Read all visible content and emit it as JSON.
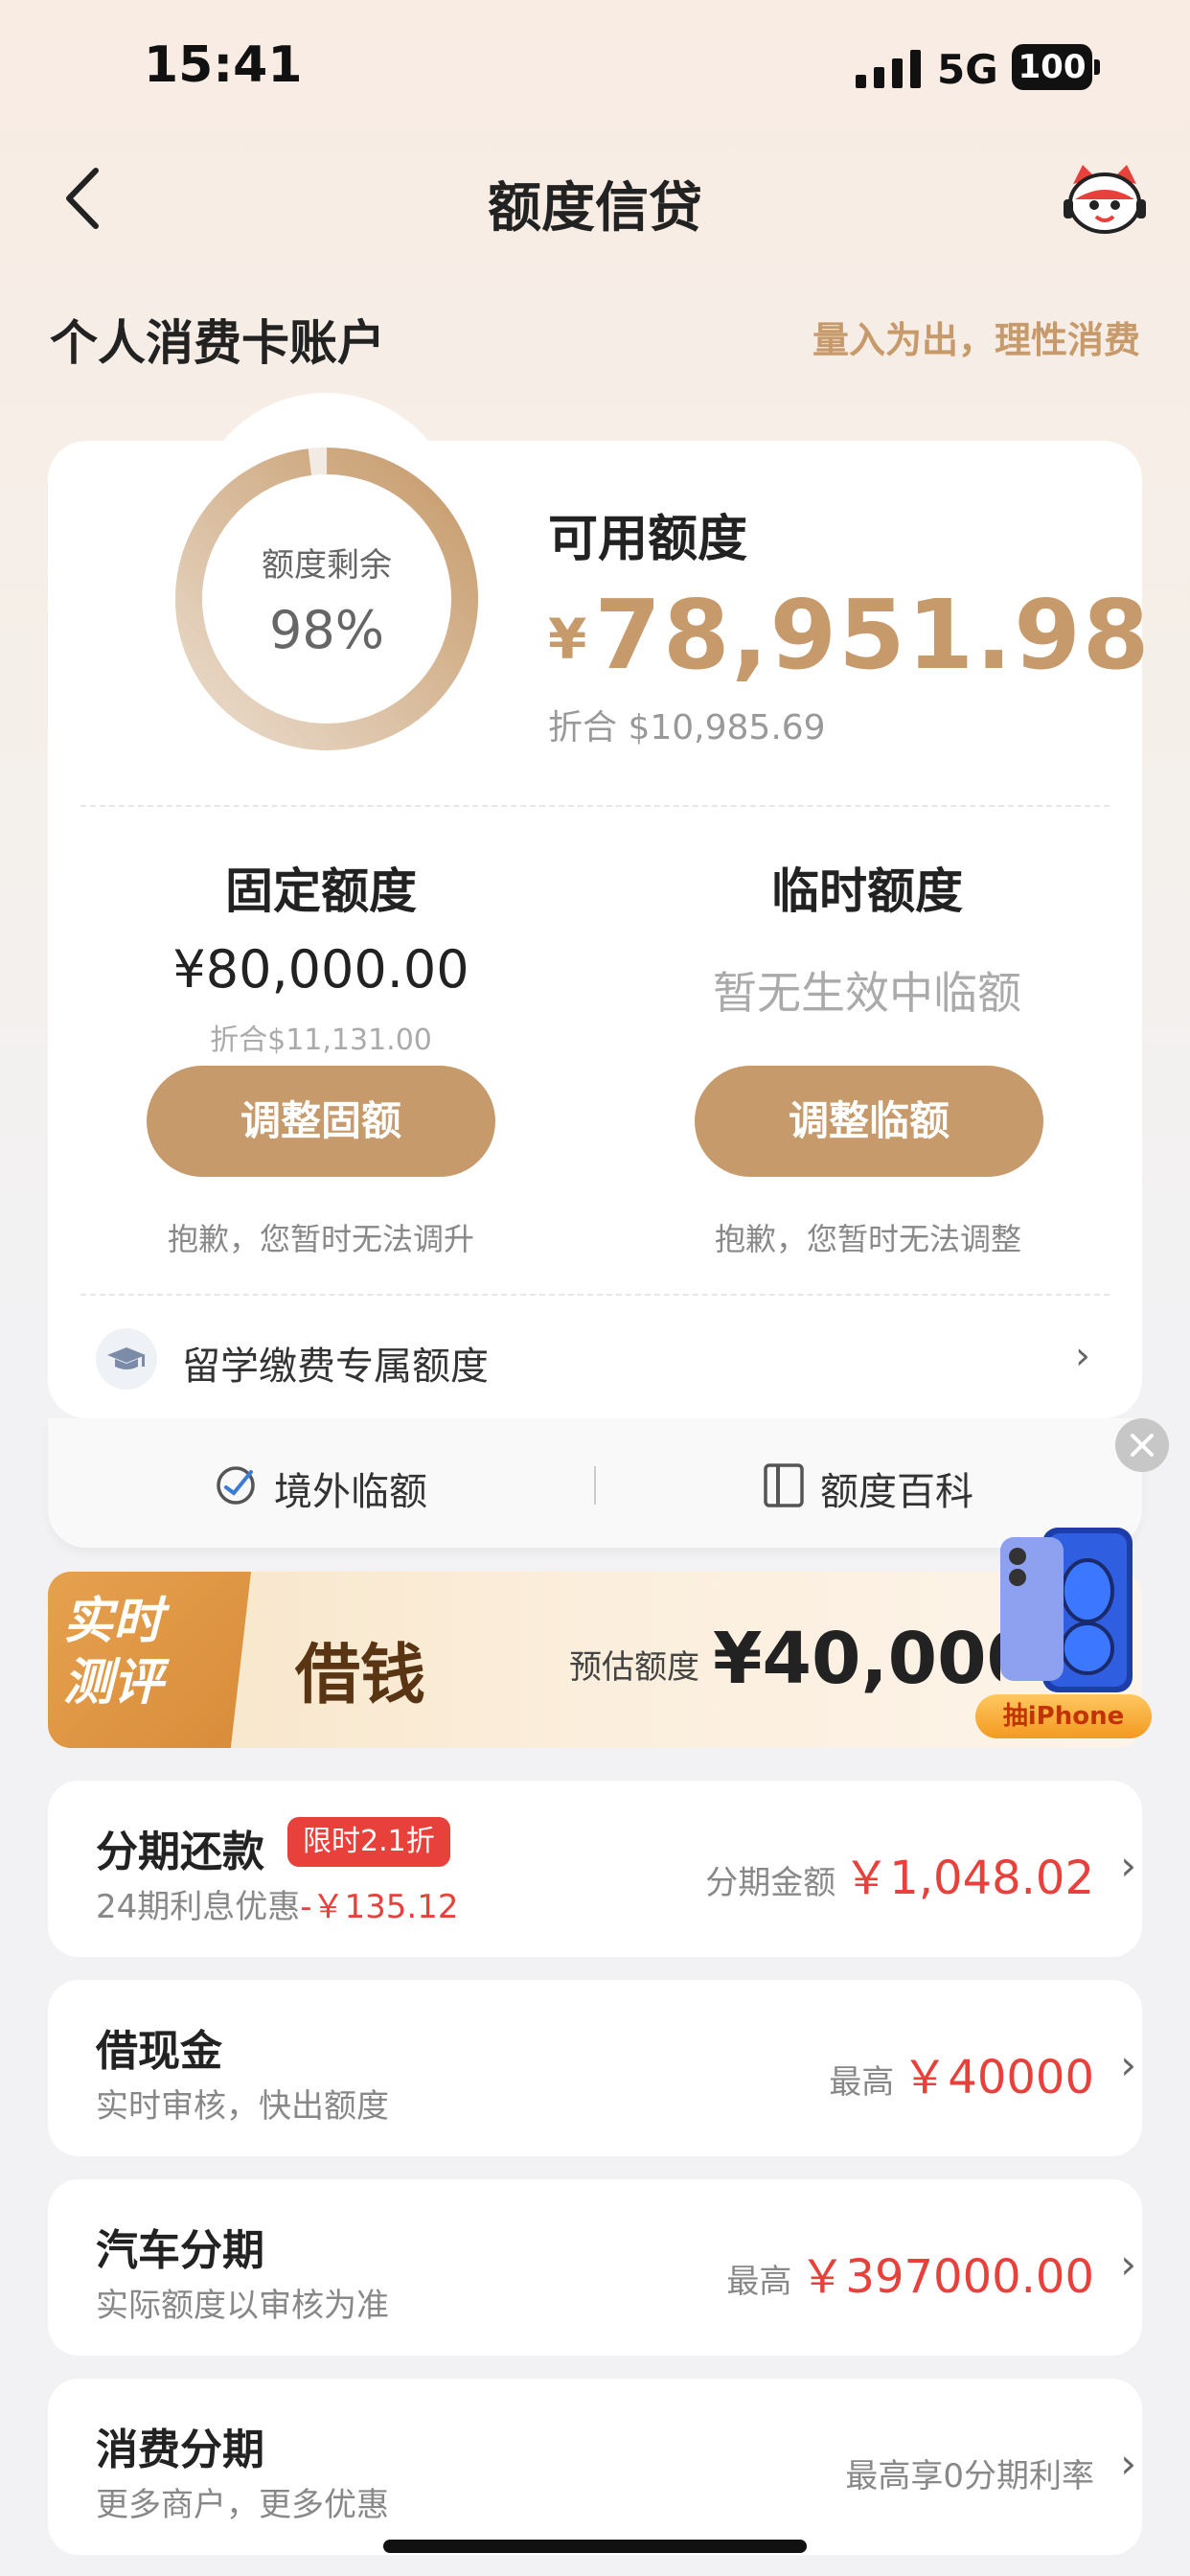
{
  "status_bar": {
    "time": "15:41",
    "network": "5G",
    "battery": "100"
  },
  "nav": {
    "title": "额度信贷"
  },
  "section": {
    "title": "个人消费卡账户",
    "slogan": "量入为出，理性消费"
  },
  "credit": {
    "ring_label": "额度剩余",
    "ring_percent": "98%",
    "ring_fraction": 0.98,
    "available_label": "可用额度",
    "currency": "¥",
    "available_amount": "78,951.98",
    "available_converted": "折合 $10,985.69"
  },
  "fixed": {
    "title": "固定额度",
    "amount": "¥80,000.00",
    "converted": "折合$11,131.00",
    "button": "调整固额",
    "note": "抱歉，您暂时无法调升"
  },
  "temporary": {
    "title": "临时额度",
    "status": "暂无生效中临额",
    "button": "调整临额",
    "note": "抱歉，您暂时无法调整"
  },
  "study": {
    "label": "留学缴费专属额度"
  },
  "strip": {
    "overseas": "境外临额",
    "wiki": "额度百科"
  },
  "banner": {
    "tag_line1": "实时",
    "tag_line2": "测评",
    "title": "借钱",
    "estimate_label": "预估额度",
    "estimate_amount": "¥40,000.0",
    "promo": "抽iPhone"
  },
  "list": [
    {
      "title": "分期还款",
      "badge": "限时2.1折",
      "sub_prefix": "24期利息优惠",
      "sub_discount": "-￥135.12",
      "right_label": "分期金额",
      "right_value": "￥1,048.02"
    },
    {
      "title": "借现金",
      "sub": "实时审核，快出额度",
      "right_label": "最高",
      "right_value": "￥40000"
    },
    {
      "title": "汽车分期",
      "sub": "实际额度以审核为准",
      "right_label": "最高",
      "right_value": "￥397000.00"
    },
    {
      "title": "消费分期",
      "sub": "更多商户，更多优惠",
      "right_label": "最高享0分期利率"
    }
  ],
  "colors": {
    "gold": "#c69a6a",
    "red": "#e8403a"
  }
}
